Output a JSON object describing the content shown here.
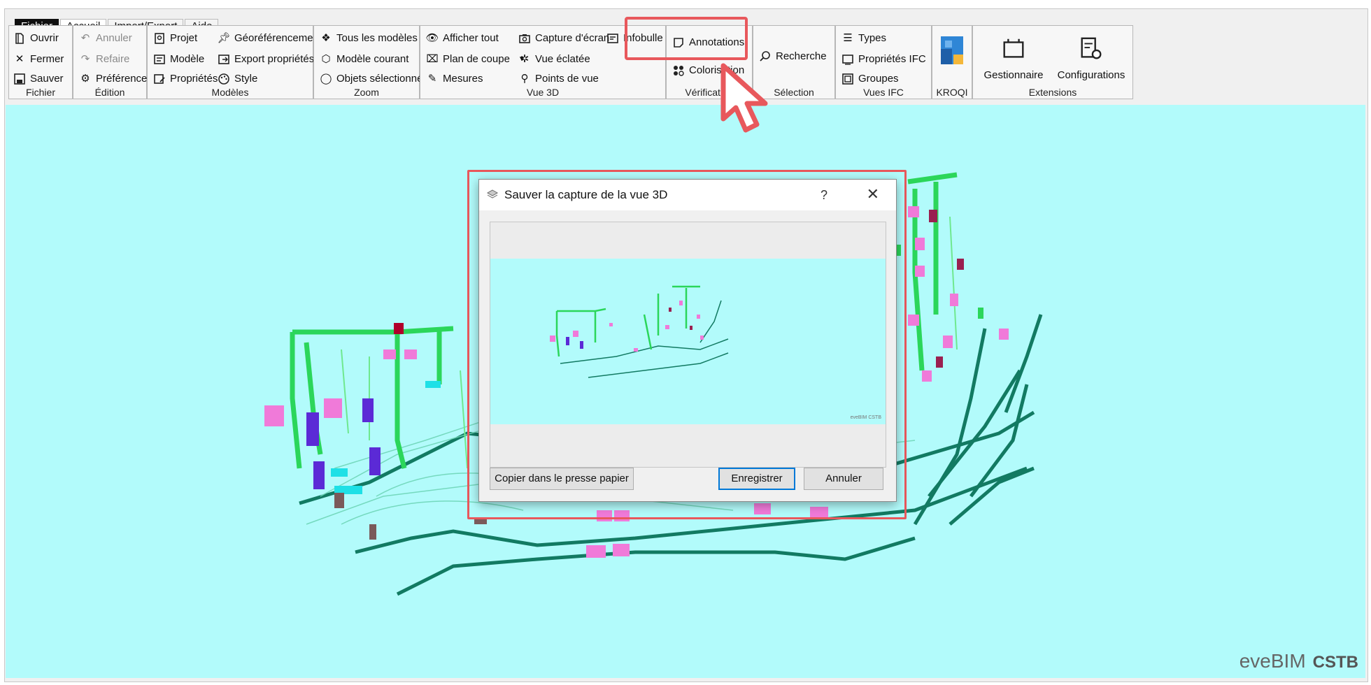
{
  "menu": {
    "tabs": [
      "Fichier",
      "Accueil",
      "Import/Export",
      "Aide"
    ]
  },
  "ribbon": {
    "fichier": {
      "label": "Fichier",
      "open": "Ouvrir",
      "close": "Fermer",
      "save": "Sauver"
    },
    "edition": {
      "label": "Édition",
      "undo": "Annuler",
      "redo": "Refaire",
      "prefs": "Préférences"
    },
    "modeles": {
      "label": "Modèles",
      "project": "Projet",
      "model": "Modèle",
      "properties": "Propriétés",
      "georef": "Géoréférencement",
      "export_props": "Export propriétés",
      "style": "Style"
    },
    "zoom": {
      "label": "Zoom",
      "all_models": "Tous les modèles",
      "current_model": "Modèle courant",
      "selected_objects": "Objets sélectionnés"
    },
    "vue3d": {
      "label": "Vue 3D",
      "show_all": "Afficher tout",
      "section_plane": "Plan de coupe",
      "measures": "Mesures",
      "screenshot": "Capture d'écran",
      "exploded_view": "Vue éclatée",
      "viewpoints": "Points de vue",
      "tooltip": "Infobulle"
    },
    "verification": {
      "label": "Vérification",
      "annotations": "Annotations",
      "colorisation": "Colorisation"
    },
    "selection": {
      "label": "Sélection",
      "search": "Recherche"
    },
    "vues_ifc": {
      "label": "Vues IFC",
      "types": "Types",
      "ifc_props": "Propriétés IFC",
      "groups": "Groupes"
    },
    "kroqi": {
      "label": "KROQI"
    },
    "extensions": {
      "label": "Extensions",
      "manager": "Gestionnaire",
      "configs": "Configurations"
    }
  },
  "dialog": {
    "title": "Sauver la capture de la vue 3D",
    "help": "?",
    "close": "✕",
    "copy_btn": "Copier dans le presse papier",
    "save_btn": "Enregistrer",
    "cancel_btn": "Annuler",
    "preview_brand": "eveBIM CSTB"
  },
  "brand": {
    "product": "eveBIM",
    "org": "CSTB"
  },
  "colors": {
    "viewport_bg": "#b2fbfb",
    "highlight": "#e8585c",
    "pipe_green": "#2bd65a",
    "pipe_teal": "#127a62",
    "magenta": "#f07ad9",
    "purple": "#5b2ad6"
  }
}
